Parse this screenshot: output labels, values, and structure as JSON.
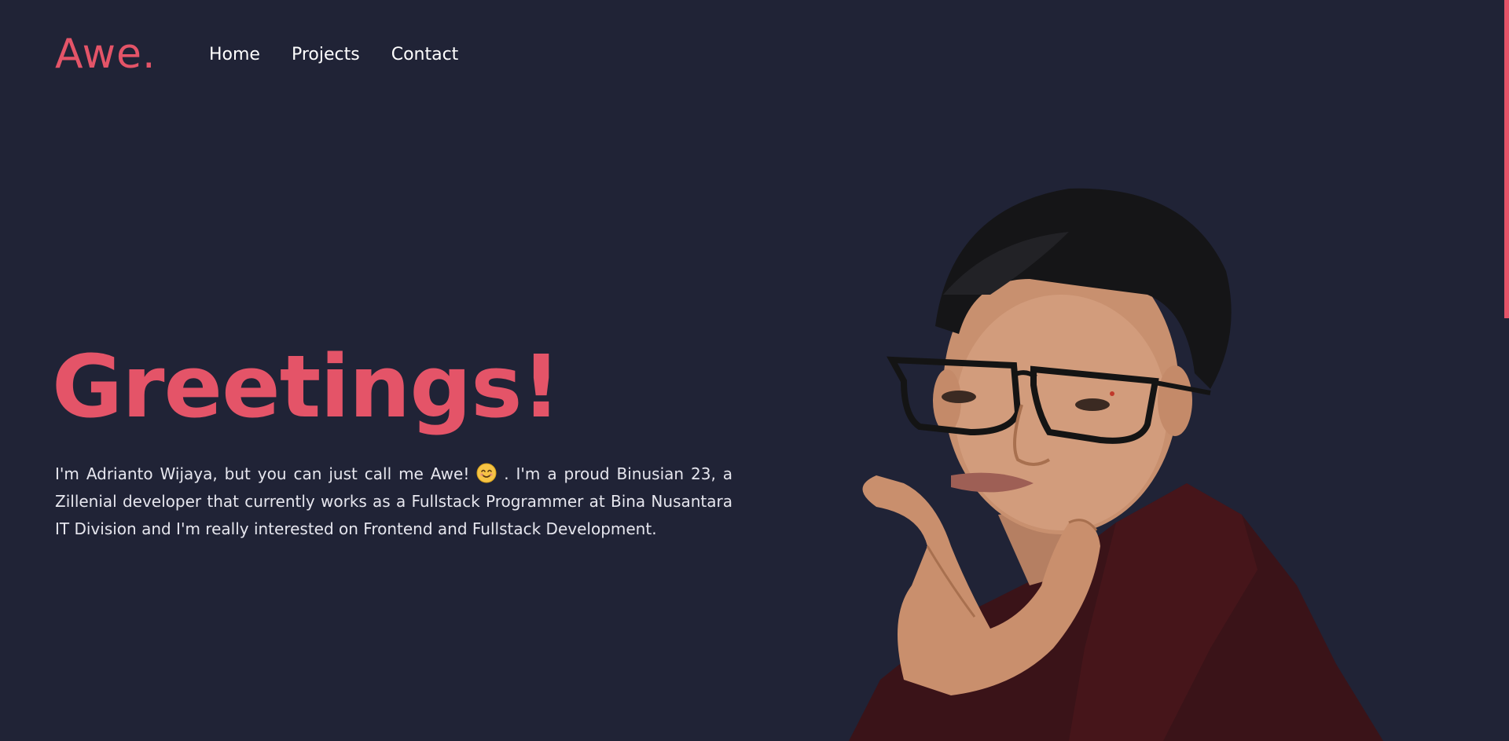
{
  "header": {
    "logo": "Awe.",
    "nav": [
      {
        "label": "Home"
      },
      {
        "label": "Projects"
      },
      {
        "label": "Contact"
      }
    ]
  },
  "hero": {
    "title": "Greetings!",
    "intro_before_emoji": "I'm Adrianto Wijaya, but you can just call me Awe!",
    "emoji": "smiling-face-emoji",
    "intro_after_emoji": ". I'm a proud Binusian 23, a Zillenial developer that currently works as a Fullstack Programmer at Bina Nusantara IT Division and I'm really interested on Frontend and Fullstack Development."
  },
  "portrait": {
    "icon": "portrait-photo"
  },
  "colors": {
    "background": "#202336",
    "accent": "#e45468",
    "text": "#e6e6ee",
    "nav_text": "#ffffff"
  }
}
